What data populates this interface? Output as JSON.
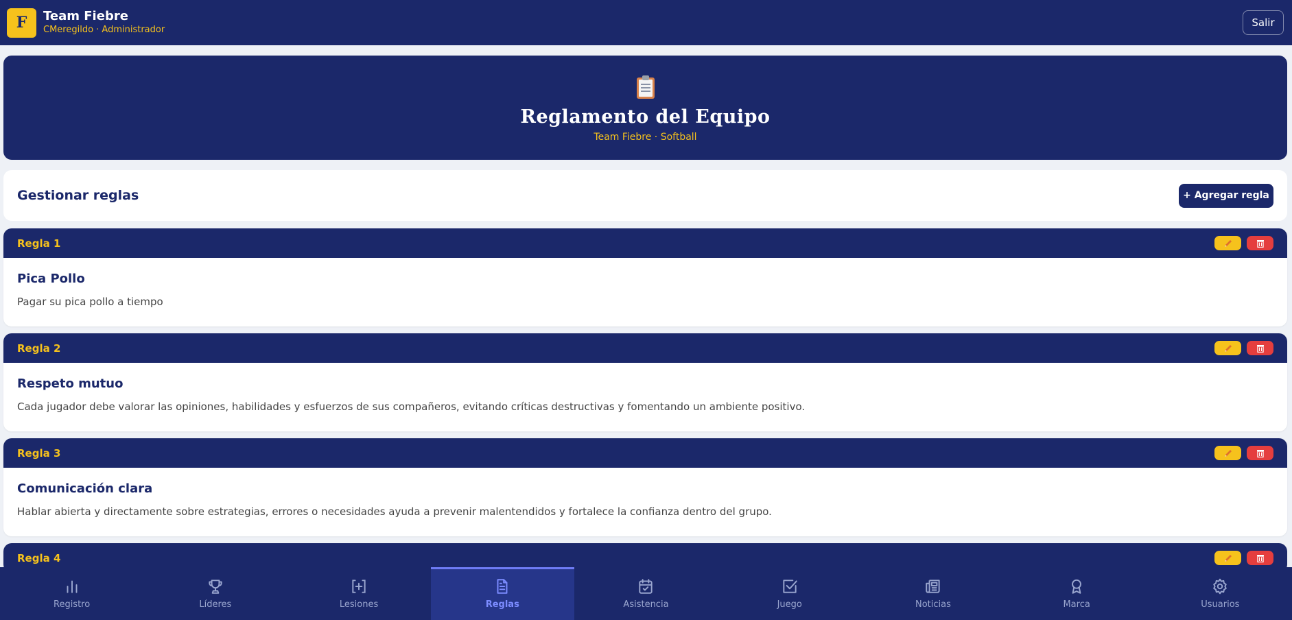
{
  "header": {
    "logo_letter": "F",
    "team_name": "Team Fiebre",
    "user_role": "CMeregildo · Administrador",
    "exit_label": "Salir"
  },
  "hero": {
    "icon": "clipboard-icon",
    "title": "Reglamento del Equipo",
    "subtitle": "Team Fiebre · Softball"
  },
  "manage": {
    "title": "Gestionar reglas",
    "add_label": "+ Agregar regla"
  },
  "rules": [
    {
      "number": "Regla 1",
      "title": "Pica Pollo",
      "description": "Pagar su pica pollo a tiempo"
    },
    {
      "number": "Regla 2",
      "title": "Respeto mutuo",
      "description": "Cada jugador debe valorar las opiniones, habilidades y esfuerzos de sus compañeros, evitando críticas destructivas y fomentando un ambiente positivo."
    },
    {
      "number": "Regla 3",
      "title": "Comunicación clara",
      "description": "Hablar abierta y directamente sobre estrategias, errores o necesidades ayuda a prevenir malentendidos y fortalece la confianza dentro del grupo."
    },
    {
      "number": "Regla 4"
    }
  ],
  "nav": [
    {
      "label": "Registro",
      "icon": "bar-chart-icon"
    },
    {
      "label": "Líderes",
      "icon": "trophy-icon"
    },
    {
      "label": "Lesiones",
      "icon": "medical-plus-icon"
    },
    {
      "label": "Reglas",
      "icon": "document-icon",
      "active": true
    },
    {
      "label": "Asistencia",
      "icon": "calendar-check-icon"
    },
    {
      "label": "Juego",
      "icon": "checkbox-icon"
    },
    {
      "label": "Noticias",
      "icon": "newspaper-icon"
    },
    {
      "label": "Marca",
      "icon": "award-icon"
    },
    {
      "label": "Usuarios",
      "icon": "gear-icon"
    }
  ],
  "colors": {
    "navy": "#1b286a",
    "gold": "#f6c21c",
    "danger": "#e53e3e",
    "active_nav": "#7c8cff"
  }
}
